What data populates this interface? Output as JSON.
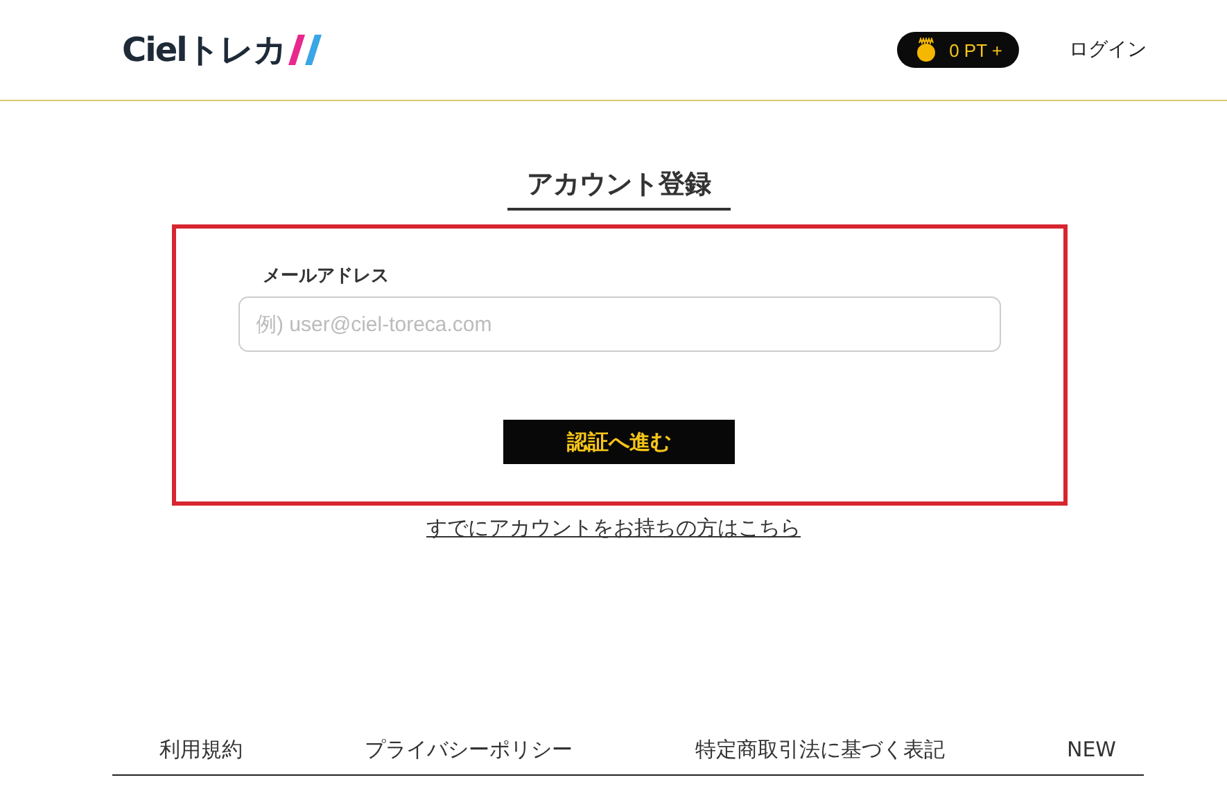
{
  "header": {
    "logo": "Cielトレカ",
    "points": "0 PT +",
    "login": "ログイン"
  },
  "form": {
    "title": "アカウント登録",
    "email_label": "メールアドレス",
    "email_placeholder": "例) user@ciel-toreca.com",
    "submit": "認証へ進む",
    "login_link": "すでにアカウントをお持ちの方はこちら"
  },
  "footer": {
    "links": [
      "利用規約",
      "プライバシーポリシー",
      "特定商取引法に基づく表記",
      "NEW"
    ]
  }
}
